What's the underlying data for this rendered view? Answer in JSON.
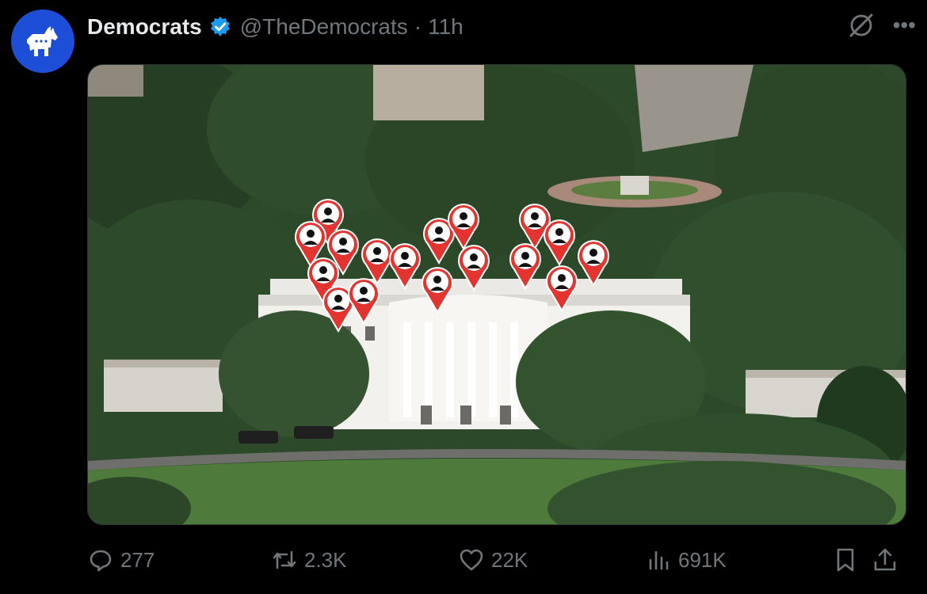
{
  "post": {
    "author_name": "Democrats",
    "handle": "@TheDemocrats",
    "separator": "·",
    "time": "11h",
    "verified": true,
    "avatar_icon": "donkey-icon",
    "avatar_color": "#1d4ed8",
    "media_description_icon": "white-house-map-pins-image"
  },
  "metrics": {
    "replies": "277",
    "reposts": "2.3K",
    "likes": "22K",
    "views": "691K"
  },
  "colors": {
    "background": "#000000",
    "muted": "#71767b",
    "verified_blue": "#1d9bf0",
    "pin_red": "#e3342f"
  }
}
